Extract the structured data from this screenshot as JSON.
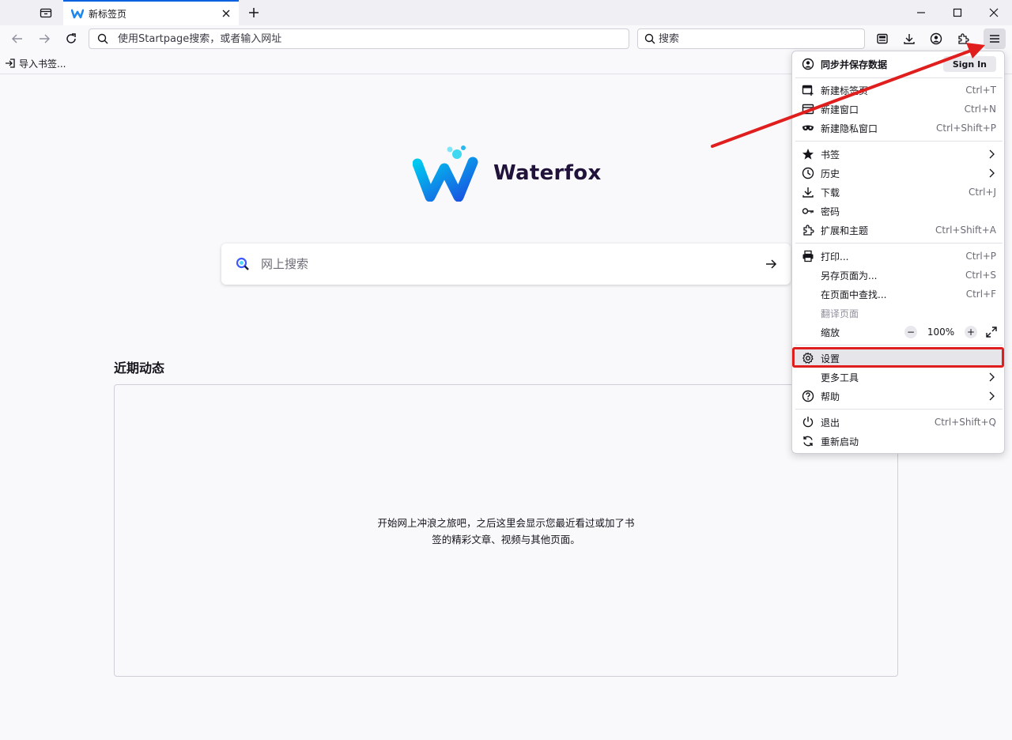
{
  "tab": {
    "title": "新标签页"
  },
  "navbar": {
    "url_placeholder": "使用Startpage搜索，或者输入网址",
    "search_placeholder": "搜索"
  },
  "bookmarks": {
    "import_label": "导入书签..."
  },
  "content": {
    "brand_name": "Waterfox",
    "websearch_placeholder": "网上搜索",
    "recent_title": "近期动态",
    "recent_empty_line1": "开始网上冲浪之旅吧，之后这里会显示您最近看过或加了书",
    "recent_empty_line2": "签的精彩文章、视频与其他页面。"
  },
  "menu": {
    "sync_label": "同步并保存数据",
    "signin_label": "Sign In",
    "items": [
      {
        "label": "新建标签页",
        "shortcut": "Ctrl+T",
        "icon": "new-tab-icon"
      },
      {
        "label": "新建窗口",
        "shortcut": "Ctrl+N",
        "icon": "new-window-icon"
      },
      {
        "label": "新建隐私窗口",
        "shortcut": "Ctrl+Shift+P",
        "icon": "private-mask-icon"
      },
      {
        "label": "书签",
        "shortcut": "",
        "icon": "star-icon"
      },
      {
        "label": "历史",
        "shortcut": "",
        "icon": "clock-icon"
      },
      {
        "label": "下载",
        "shortcut": "Ctrl+J",
        "icon": "download-icon"
      },
      {
        "label": "密码",
        "shortcut": "",
        "icon": "key-icon"
      },
      {
        "label": "扩展和主题",
        "shortcut": "Ctrl+Shift+A",
        "icon": "puzzle-icon"
      },
      {
        "label": "打印...",
        "shortcut": "Ctrl+P",
        "icon": "printer-icon"
      },
      {
        "label": "另存页面为...",
        "shortcut": "Ctrl+S",
        "icon": ""
      },
      {
        "label": "在页面中查找...",
        "shortcut": "Ctrl+F",
        "icon": ""
      },
      {
        "label": "翻译页面",
        "shortcut": "",
        "icon": ""
      },
      {
        "label": "缩放",
        "shortcut": "",
        "icon": ""
      },
      {
        "label": "设置",
        "shortcut": "",
        "icon": "gear-icon"
      },
      {
        "label": "更多工具",
        "shortcut": "",
        "icon": ""
      },
      {
        "label": "帮助",
        "shortcut": "",
        "icon": "help-icon"
      },
      {
        "label": "退出",
        "shortcut": "Ctrl+Shift+Q",
        "icon": "power-icon"
      },
      {
        "label": "重新启动",
        "shortcut": "",
        "icon": "restart-icon"
      }
    ],
    "zoom_value": "100%",
    "zoom_minus": "−",
    "zoom_plus": "+"
  },
  "colors": {
    "accent": "#0061e0",
    "annotation_red": "#e01e1e",
    "logo_blue": "#1e88f0",
    "logo_text": "#20123a"
  }
}
